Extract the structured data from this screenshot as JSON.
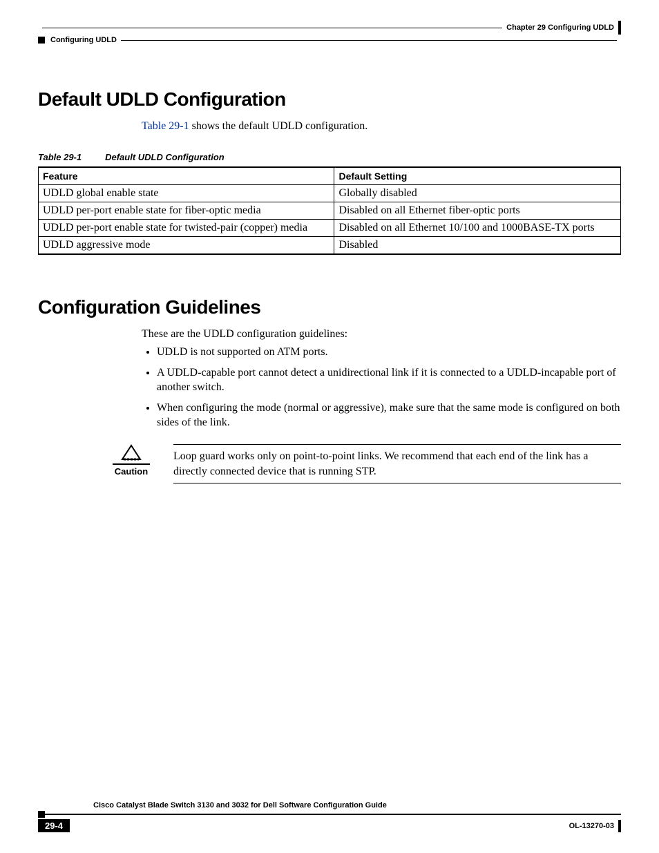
{
  "header": {
    "chapter": "Chapter 29    Configuring UDLD",
    "section": "Configuring UDLD"
  },
  "sec1": {
    "heading": "Default UDLD Configuration",
    "intro_xref": "Table 29-1",
    "intro_rest": " shows the default UDLD configuration.",
    "table_num": "Table 29-1",
    "table_title": "Default UDLD Configuration",
    "col1": "Feature",
    "col2": "Default Setting",
    "rows": [
      {
        "f": "UDLD global enable state",
        "d": "Globally disabled"
      },
      {
        "f": "UDLD per-port enable state for fiber-optic media",
        "d": "Disabled on all Ethernet fiber-optic ports"
      },
      {
        "f": "UDLD per-port enable state for twisted-pair (copper) media",
        "d": "Disabled on all Ethernet 10/100 and 1000BASE-TX ports"
      },
      {
        "f": "UDLD aggressive mode",
        "d": "Disabled"
      }
    ]
  },
  "sec2": {
    "heading": "Configuration Guidelines",
    "intro": "These are the UDLD configuration guidelines:",
    "bullets": [
      "UDLD is not supported on ATM ports.",
      "A UDLD-capable port cannot detect a unidirectional link if it is connected to a UDLD-incapable port of another switch.",
      "When configuring the mode (normal or aggressive), make sure that the same mode is configured on both sides of the link."
    ],
    "caution_label": "Caution",
    "caution_text": "Loop guard works only on point-to-point links. We recommend that each end of the link has a directly connected device that is running STP."
  },
  "footer": {
    "doc_title": "Cisco Catalyst Blade Switch 3130 and 3032 for Dell Software Configuration Guide",
    "page": "29-4",
    "doc_code": "OL-13270-03"
  }
}
